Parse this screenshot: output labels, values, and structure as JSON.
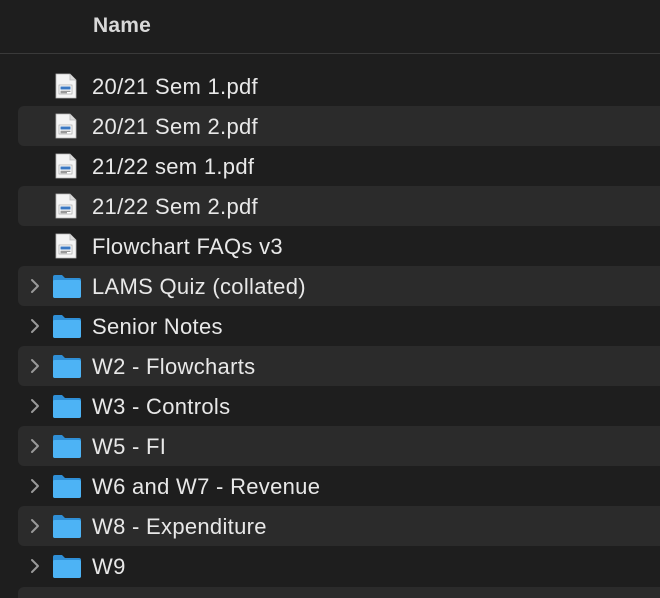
{
  "header": {
    "name_label": "Name"
  },
  "files": [
    {
      "name": "20/21 Sem 1.pdf",
      "kind": "pdf",
      "icon": "pdf-document-icon"
    },
    {
      "name": "20/21 Sem 2.pdf",
      "kind": "pdf",
      "icon": "pdf-document-icon"
    },
    {
      "name": "21/22 sem 1.pdf",
      "kind": "pdf",
      "icon": "pdf-document-icon"
    },
    {
      "name": "21/22 Sem 2.pdf",
      "kind": "pdf",
      "icon": "pdf-document-icon"
    },
    {
      "name": "Flowchart FAQs v3",
      "kind": "document",
      "icon": "document-icon"
    },
    {
      "name": "LAMS Quiz (collated)",
      "kind": "folder",
      "icon": "folder-icon"
    },
    {
      "name": "Senior Notes",
      "kind": "folder",
      "icon": "folder-icon"
    },
    {
      "name": "W2 - Flowcharts",
      "kind": "folder",
      "icon": "folder-icon"
    },
    {
      "name": "W3 - Controls",
      "kind": "folder",
      "icon": "folder-icon"
    },
    {
      "name": "W5 - FI",
      "kind": "folder",
      "icon": "folder-icon"
    },
    {
      "name": "W6 and W7 - Revenue",
      "kind": "folder",
      "icon": "folder-icon"
    },
    {
      "name": "W8 - Expenditure",
      "kind": "folder",
      "icon": "folder-icon"
    },
    {
      "name": "W9",
      "kind": "folder",
      "icon": "folder-icon"
    }
  ],
  "colors": {
    "background": "#1e1e1e",
    "alt_row": "#2b2b2b",
    "folder_blue": "#3fa9f0",
    "text": "#e8e8e8"
  }
}
